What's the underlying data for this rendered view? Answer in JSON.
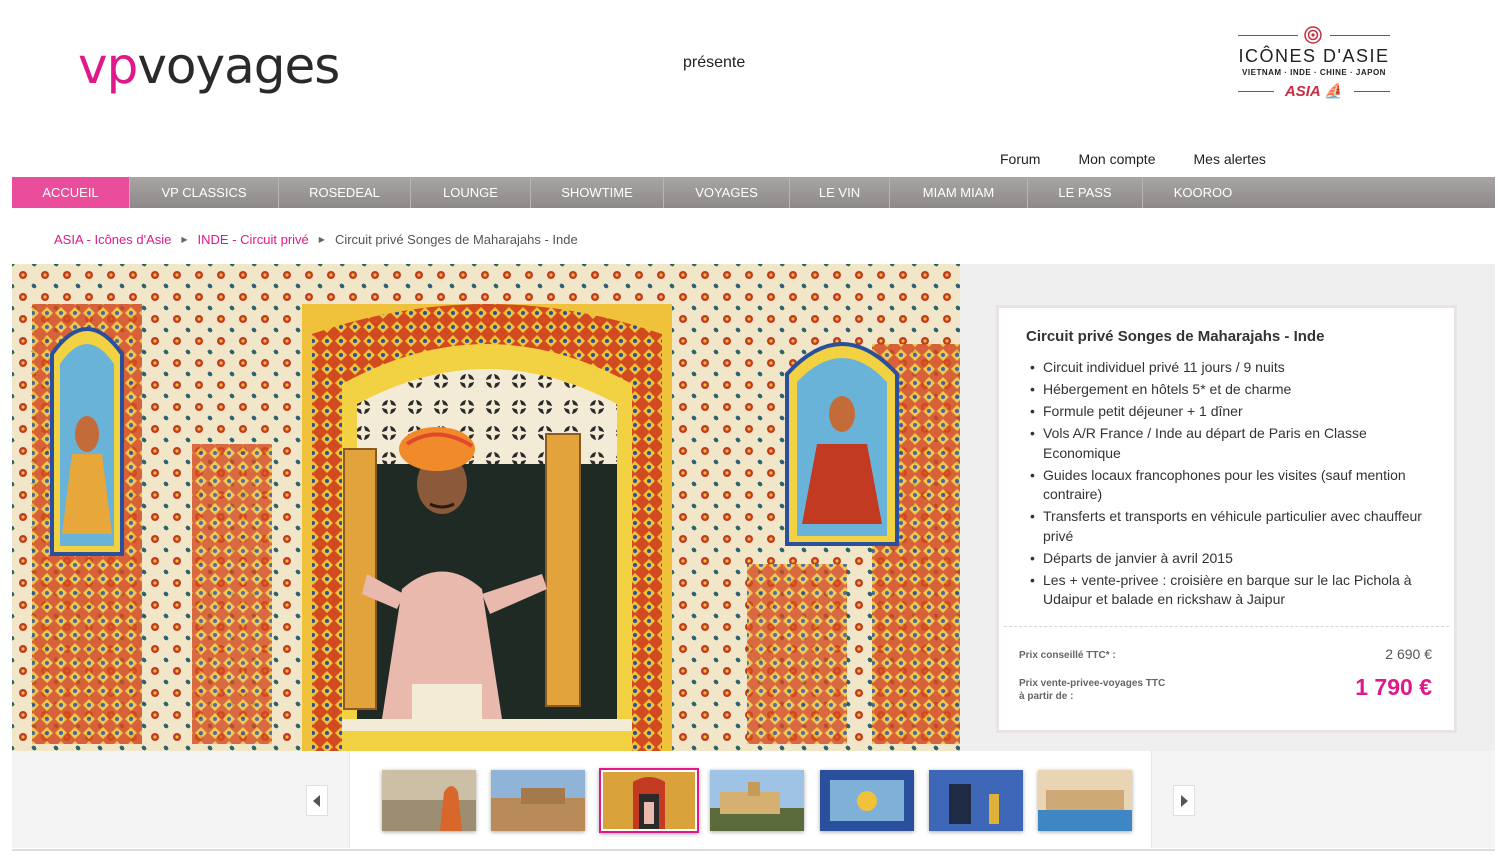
{
  "header": {
    "logo_vp": "vp",
    "logo_voyages": "voyages",
    "presente": "présente",
    "partner_title": "ICÔNES D'ASIE",
    "partner_sub": "VIETNAM · INDE · CHINE · JAPON",
    "partner_brand": "ASIA",
    "links": [
      "Forum",
      "Mon compte",
      "Mes alertes"
    ]
  },
  "nav": {
    "items": [
      "ACCUEIL",
      "VP CLASSICS",
      "ROSEDEAL",
      "LOUNGE",
      "SHOWTIME",
      "VOYAGES",
      "LE VIN",
      "MIAM MIAM",
      "LE PASS",
      "KOOROO"
    ],
    "active_index": 0
  },
  "breadcrumb": {
    "items": [
      "ASIA - Icônes d'Asie",
      "INDE - Circuit privé"
    ],
    "current": "Circuit privé Songes de Maharajahs - Inde"
  },
  "offer": {
    "title": "Circuit privé Songes de Maharajahs - Inde",
    "features": [
      "Circuit individuel privé 11 jours / 9 nuits",
      "Hébergement en hôtels 5* et de charme",
      "Formule petit déjeuner + 1 dîner",
      "Vols A/R France / Inde au départ de Paris en Classe Economique",
      "Guides locaux francophones pour les visites (sauf mention contraire)",
      "Transferts et transports en véhicule particulier avec chauffeur privé",
      "Départs de janvier à avril 2015",
      "Les + vente-privee : croisière en barque sur le lac Pichola à Udaipur et balade en rickshaw à Jaipur"
    ],
    "price_label": "Prix conseillé TTC* :",
    "price_value": "2 690 €",
    "sale_label": "Prix vente-privee-voyages TTC à partir de :",
    "sale_value": "1 790 €"
  },
  "colors": {
    "brand_pink": "#e0198a",
    "nav_active": "#e94d9b",
    "nav_gray": "#9a9695",
    "partner_red": "#c62c42"
  },
  "gallery": {
    "active_index": 2
  }
}
